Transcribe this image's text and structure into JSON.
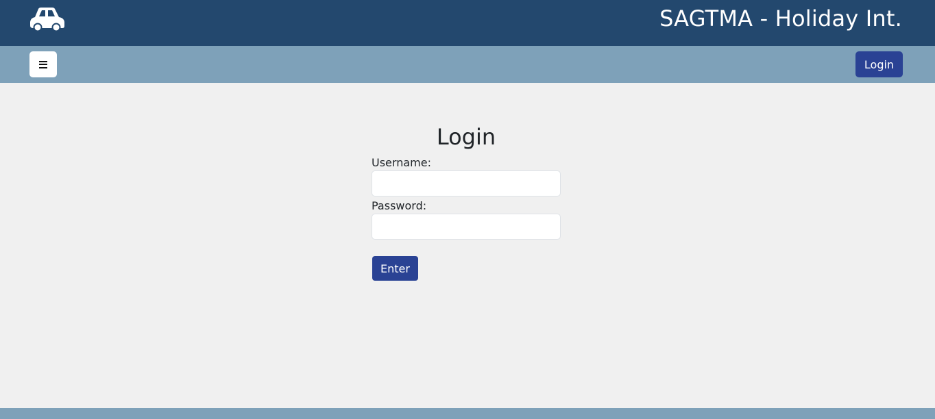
{
  "header": {
    "logo_icon": "car-icon",
    "title": "SAGTMA - Holiday Int.",
    "background": "#23486e"
  },
  "navbar": {
    "menu_icon": "hamburger-menu-icon",
    "login_label": "Login",
    "background": "#7ea1b9",
    "accent": "#2a4294"
  },
  "login_form": {
    "title": "Login",
    "username_label": "Username:",
    "username_value": "",
    "password_label": "Password:",
    "password_value": "",
    "submit_label": "Enter"
  },
  "footer": {
    "background": "#7ea1b9"
  }
}
